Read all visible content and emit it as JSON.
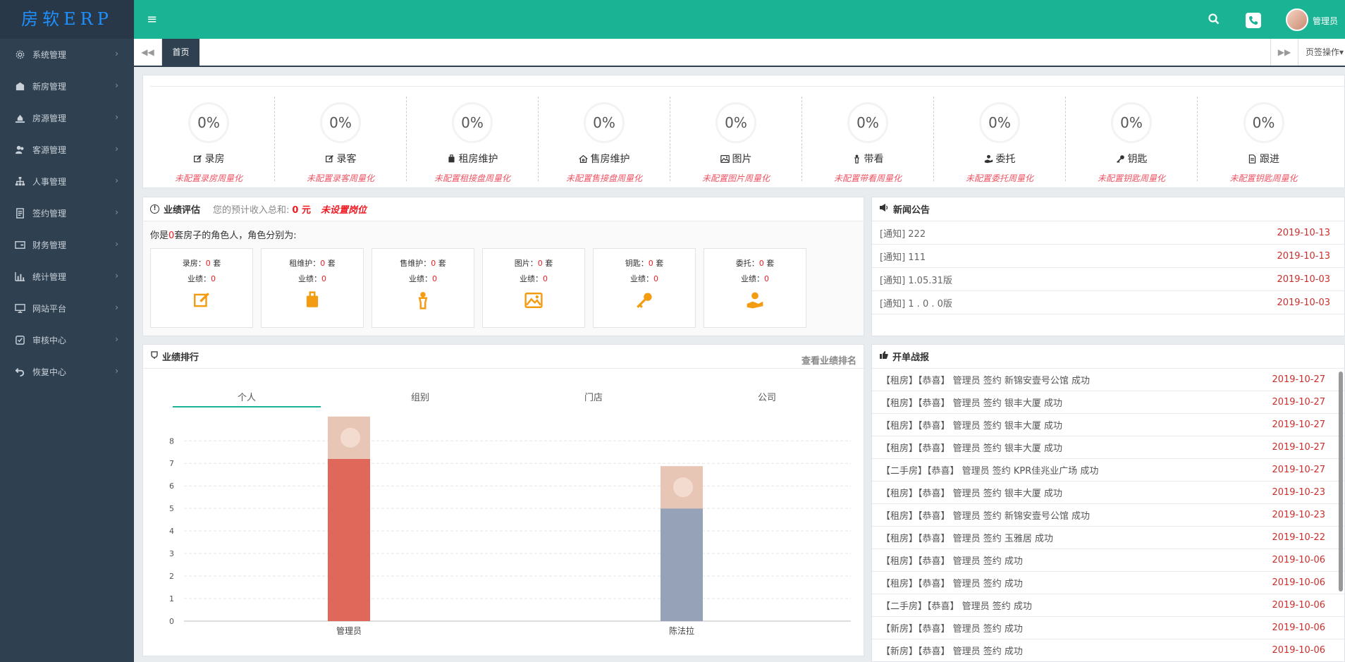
{
  "app": {
    "logo": "房软ERP"
  },
  "sidebar": {
    "items": [
      {
        "label": "系统管理",
        "icon": "gear-icon"
      },
      {
        "label": "新房管理",
        "icon": "building-icon"
      },
      {
        "label": "房源管理",
        "icon": "house-hand-icon"
      },
      {
        "label": "客源管理",
        "icon": "users-icon"
      },
      {
        "label": "人事管理",
        "icon": "sitemap-icon"
      },
      {
        "label": "签约管理",
        "icon": "contract-icon"
      },
      {
        "label": "财务管理",
        "icon": "card-icon"
      },
      {
        "label": "统计管理",
        "icon": "bar-chart-icon"
      },
      {
        "label": "网站平台",
        "icon": "monitor-icon"
      },
      {
        "label": "审核中心",
        "icon": "check-icon"
      },
      {
        "label": "恢复中心",
        "icon": "undo-icon"
      }
    ],
    "chevron": "›"
  },
  "topbar": {
    "menu_icon": "≡",
    "user": "管理员"
  },
  "tabs": {
    "home": "首页",
    "ops": "页签操作▾",
    "prev": "◀◀",
    "next": "▶▶"
  },
  "stats": [
    {
      "pct": "0%",
      "label": "录房",
      "note": "未配置录房周量化",
      "icon": "edit-icon"
    },
    {
      "pct": "0%",
      "label": "录客",
      "note": "未配置录客周量化",
      "icon": "edit-icon"
    },
    {
      "pct": "0%",
      "label": "租房维护",
      "note": "未配置租接盘周量化",
      "icon": "suitcase-icon"
    },
    {
      "pct": "0%",
      "label": "售房维护",
      "note": "未配置售接盘周量化",
      "icon": "home-icon"
    },
    {
      "pct": "0%",
      "label": "图片",
      "note": "未配置图片周量化",
      "icon": "image-icon"
    },
    {
      "pct": "0%",
      "label": "带看",
      "note": "未配置带看周量化",
      "icon": "person-icon"
    },
    {
      "pct": "0%",
      "label": "委托",
      "note": "未配置委托周量化",
      "icon": "hand-icon"
    },
    {
      "pct": "0%",
      "label": "钥匙",
      "note": "未配置钥匙周量化",
      "icon": "key-icon"
    },
    {
      "pct": "0%",
      "label": "跟进",
      "note": "未配置钥匙周量化",
      "icon": "doc-icon"
    }
  ],
  "performance": {
    "title": "业绩评估",
    "income_label": "您的预计收入总和:",
    "income_value": "0 元",
    "warning": "未设置岗位",
    "role_prefix": "你是",
    "role_count": "0",
    "role_suffix": "套房子的角色人，角色分别为:",
    "cards": [
      {
        "name": "录房",
        "count": "0",
        "unit": "套",
        "perf_label": "业绩",
        "perf": "0"
      },
      {
        "name": "租维护",
        "count": "0",
        "unit": "套",
        "perf_label": "业绩",
        "perf": "0"
      },
      {
        "name": "售维护",
        "count": "0",
        "unit": "套",
        "perf_label": "业绩",
        "perf": "0"
      },
      {
        "name": "图片",
        "count": "0",
        "unit": "套",
        "perf_label": "业绩",
        "perf": "0"
      },
      {
        "name": "钥匙",
        "count": "0",
        "unit": "套",
        "perf_label": "业绩",
        "perf": "0"
      },
      {
        "name": "委托",
        "count": "0",
        "unit": "套",
        "perf_label": "业绩",
        "perf": "0"
      }
    ]
  },
  "news": {
    "title": "新闻公告",
    "items": [
      {
        "text": "[通知] 222",
        "date": "2019-10-13"
      },
      {
        "text": "[通知] 111",
        "date": "2019-10-13"
      },
      {
        "text": "[通知] 1.05.31版",
        "date": "2019-10-03"
      },
      {
        "text": "[通知] 1 . 0 . 0版",
        "date": "2019-10-03"
      }
    ]
  },
  "ranking": {
    "title": "业绩排行",
    "link": "查看业绩排名",
    "tabs": [
      "个人",
      "组别",
      "门店",
      "公司"
    ]
  },
  "chart_data": {
    "type": "bar",
    "categories": [
      "管理员",
      "陈法拉"
    ],
    "values": [
      7.2,
      5
    ],
    "ylim": [
      0,
      8
    ],
    "yticks": [
      "0",
      "1",
      "2",
      "3",
      "4",
      "5",
      "6",
      "7",
      "8"
    ],
    "colors": [
      "#e0685a",
      "#95a2b8"
    ],
    "grid": true
  },
  "deals": {
    "title": "开单战报",
    "items": [
      {
        "text": "【租房】【恭喜】 管理员 签约 新锦安壹号公馆 成功",
        "date": "2019-10-27"
      },
      {
        "text": "【租房】【恭喜】 管理员 签约 银丰大厦 成功",
        "date": "2019-10-27"
      },
      {
        "text": "【租房】【恭喜】 管理员 签约 银丰大厦 成功",
        "date": "2019-10-27"
      },
      {
        "text": "【租房】【恭喜】 管理员 签约 银丰大厦 成功",
        "date": "2019-10-27"
      },
      {
        "text": "【二手房】【恭喜】 管理员 签约 KPR佳兆业广场 成功",
        "date": "2019-10-27"
      },
      {
        "text": "【租房】【恭喜】 管理员 签约 银丰大厦 成功",
        "date": "2019-10-23"
      },
      {
        "text": "【租房】【恭喜】 管理员 签约 新锦安壹号公馆 成功",
        "date": "2019-10-23"
      },
      {
        "text": "【租房】【恭喜】 管理员 签约 玉雅居 成功",
        "date": "2019-10-22"
      },
      {
        "text": "【租房】【恭喜】 管理员 签约 成功",
        "date": "2019-10-06"
      },
      {
        "text": "【租房】【恭喜】 管理员 签约 成功",
        "date": "2019-10-06"
      },
      {
        "text": "【二手房】【恭喜】 管理员 签约 成功",
        "date": "2019-10-06"
      },
      {
        "text": "【新房】【恭喜】 管理员 签约 成功",
        "date": "2019-10-06"
      },
      {
        "text": "【新房】【恭喜】 管理员 签约 成功",
        "date": "2019-10-06"
      }
    ]
  }
}
